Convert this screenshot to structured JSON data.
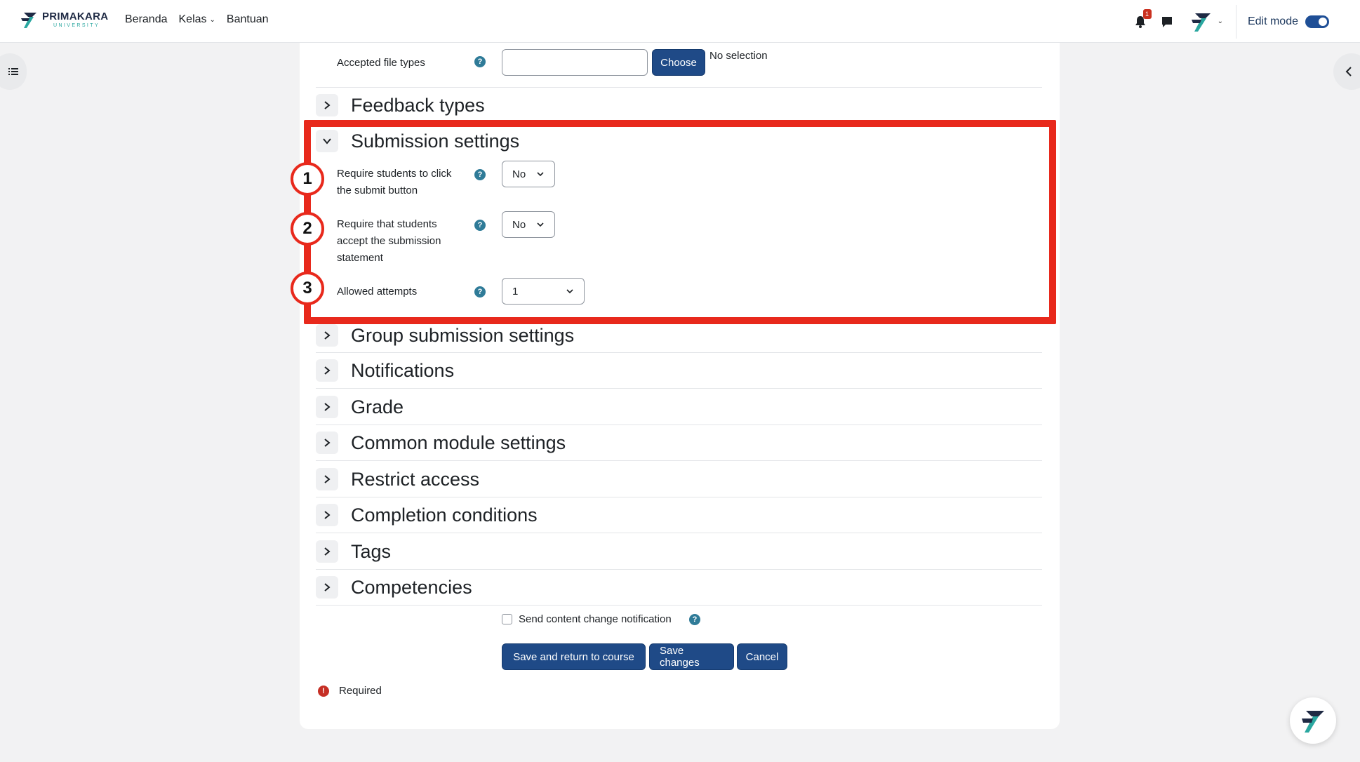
{
  "navbar": {
    "brand": "PRIMAKARA",
    "brand_sub": "UNIVERSITY",
    "links": [
      "Beranda",
      "Kelas",
      "Bantuan"
    ],
    "notification_count": "1",
    "edit_mode_label": "Edit mode",
    "edit_mode_on": true
  },
  "form": {
    "accepted_file_types": {
      "label": "Accepted file types",
      "value": "",
      "choose_label": "Choose",
      "selection_text": "No selection"
    },
    "sections": {
      "feedback_types": "Feedback types",
      "submission_settings": "Submission settings",
      "group_submission_settings": "Group submission settings",
      "notifications": "Notifications",
      "grade": "Grade",
      "common_module_settings": "Common module settings",
      "restrict_access": "Restrict access",
      "completion_conditions": "Completion conditions",
      "tags": "Tags",
      "competencies": "Competencies"
    },
    "submission": {
      "require_submit_label_1": "Require students to click",
      "require_submit_label_2": "the submit button",
      "require_submit_value": "No",
      "accept_statement_label_1": "Require that students",
      "accept_statement_label_2": "accept the submission",
      "accept_statement_label_3": "statement",
      "accept_statement_value": "No",
      "allowed_attempts_label": "Allowed attempts",
      "allowed_attempts_value": "1"
    },
    "send_notification_label": "Send content change notification",
    "send_notification_checked": false,
    "buttons": {
      "save_return": "Save and return to course",
      "save_changes": "Save changes",
      "cancel": "Cancel"
    },
    "required_label": "Required"
  },
  "annotations": {
    "step1": "1",
    "step2": "2",
    "step3": "3",
    "highlight_color": "#e8291c"
  },
  "colors": {
    "primary": "#1f4a87",
    "help": "#2f7b98",
    "danger": "#c62f25"
  },
  "icons": {
    "help": "question-circle-icon",
    "expander_collapsed": "chevron-right-icon",
    "expander_expanded": "chevron-down-icon"
  }
}
